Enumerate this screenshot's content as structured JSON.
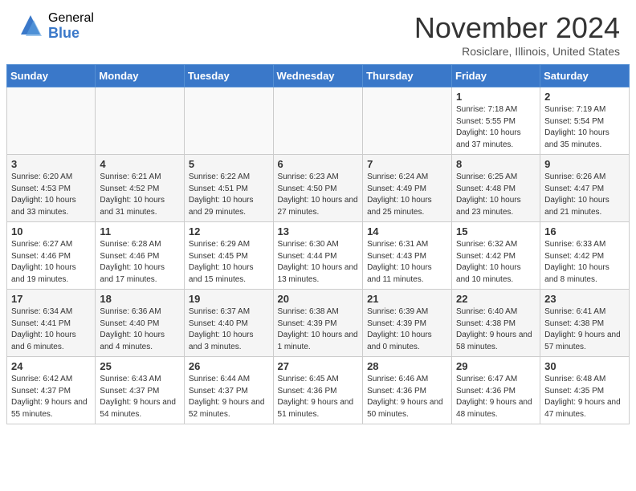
{
  "header": {
    "logo_general": "General",
    "logo_blue": "Blue",
    "month_title": "November 2024",
    "location": "Rosiclare, Illinois, United States"
  },
  "days_of_week": [
    "Sunday",
    "Monday",
    "Tuesday",
    "Wednesday",
    "Thursday",
    "Friday",
    "Saturday"
  ],
  "weeks": [
    [
      {
        "day": "",
        "info": ""
      },
      {
        "day": "",
        "info": ""
      },
      {
        "day": "",
        "info": ""
      },
      {
        "day": "",
        "info": ""
      },
      {
        "day": "",
        "info": ""
      },
      {
        "day": "1",
        "info": "Sunrise: 7:18 AM\nSunset: 5:55 PM\nDaylight: 10 hours and 37 minutes."
      },
      {
        "day": "2",
        "info": "Sunrise: 7:19 AM\nSunset: 5:54 PM\nDaylight: 10 hours and 35 minutes."
      }
    ],
    [
      {
        "day": "3",
        "info": "Sunrise: 6:20 AM\nSunset: 4:53 PM\nDaylight: 10 hours and 33 minutes."
      },
      {
        "day": "4",
        "info": "Sunrise: 6:21 AM\nSunset: 4:52 PM\nDaylight: 10 hours and 31 minutes."
      },
      {
        "day": "5",
        "info": "Sunrise: 6:22 AM\nSunset: 4:51 PM\nDaylight: 10 hours and 29 minutes."
      },
      {
        "day": "6",
        "info": "Sunrise: 6:23 AM\nSunset: 4:50 PM\nDaylight: 10 hours and 27 minutes."
      },
      {
        "day": "7",
        "info": "Sunrise: 6:24 AM\nSunset: 4:49 PM\nDaylight: 10 hours and 25 minutes."
      },
      {
        "day": "8",
        "info": "Sunrise: 6:25 AM\nSunset: 4:48 PM\nDaylight: 10 hours and 23 minutes."
      },
      {
        "day": "9",
        "info": "Sunrise: 6:26 AM\nSunset: 4:47 PM\nDaylight: 10 hours and 21 minutes."
      }
    ],
    [
      {
        "day": "10",
        "info": "Sunrise: 6:27 AM\nSunset: 4:46 PM\nDaylight: 10 hours and 19 minutes."
      },
      {
        "day": "11",
        "info": "Sunrise: 6:28 AM\nSunset: 4:46 PM\nDaylight: 10 hours and 17 minutes."
      },
      {
        "day": "12",
        "info": "Sunrise: 6:29 AM\nSunset: 4:45 PM\nDaylight: 10 hours and 15 minutes."
      },
      {
        "day": "13",
        "info": "Sunrise: 6:30 AM\nSunset: 4:44 PM\nDaylight: 10 hours and 13 minutes."
      },
      {
        "day": "14",
        "info": "Sunrise: 6:31 AM\nSunset: 4:43 PM\nDaylight: 10 hours and 11 minutes."
      },
      {
        "day": "15",
        "info": "Sunrise: 6:32 AM\nSunset: 4:42 PM\nDaylight: 10 hours and 10 minutes."
      },
      {
        "day": "16",
        "info": "Sunrise: 6:33 AM\nSunset: 4:42 PM\nDaylight: 10 hours and 8 minutes."
      }
    ],
    [
      {
        "day": "17",
        "info": "Sunrise: 6:34 AM\nSunset: 4:41 PM\nDaylight: 10 hours and 6 minutes."
      },
      {
        "day": "18",
        "info": "Sunrise: 6:36 AM\nSunset: 4:40 PM\nDaylight: 10 hours and 4 minutes."
      },
      {
        "day": "19",
        "info": "Sunrise: 6:37 AM\nSunset: 4:40 PM\nDaylight: 10 hours and 3 minutes."
      },
      {
        "day": "20",
        "info": "Sunrise: 6:38 AM\nSunset: 4:39 PM\nDaylight: 10 hours and 1 minute."
      },
      {
        "day": "21",
        "info": "Sunrise: 6:39 AM\nSunset: 4:39 PM\nDaylight: 10 hours and 0 minutes."
      },
      {
        "day": "22",
        "info": "Sunrise: 6:40 AM\nSunset: 4:38 PM\nDaylight: 9 hours and 58 minutes."
      },
      {
        "day": "23",
        "info": "Sunrise: 6:41 AM\nSunset: 4:38 PM\nDaylight: 9 hours and 57 minutes."
      }
    ],
    [
      {
        "day": "24",
        "info": "Sunrise: 6:42 AM\nSunset: 4:37 PM\nDaylight: 9 hours and 55 minutes."
      },
      {
        "day": "25",
        "info": "Sunrise: 6:43 AM\nSunset: 4:37 PM\nDaylight: 9 hours and 54 minutes."
      },
      {
        "day": "26",
        "info": "Sunrise: 6:44 AM\nSunset: 4:37 PM\nDaylight: 9 hours and 52 minutes."
      },
      {
        "day": "27",
        "info": "Sunrise: 6:45 AM\nSunset: 4:36 PM\nDaylight: 9 hours and 51 minutes."
      },
      {
        "day": "28",
        "info": "Sunrise: 6:46 AM\nSunset: 4:36 PM\nDaylight: 9 hours and 50 minutes."
      },
      {
        "day": "29",
        "info": "Sunrise: 6:47 AM\nSunset: 4:36 PM\nDaylight: 9 hours and 48 minutes."
      },
      {
        "day": "30",
        "info": "Sunrise: 6:48 AM\nSunset: 4:35 PM\nDaylight: 9 hours and 47 minutes."
      }
    ]
  ]
}
